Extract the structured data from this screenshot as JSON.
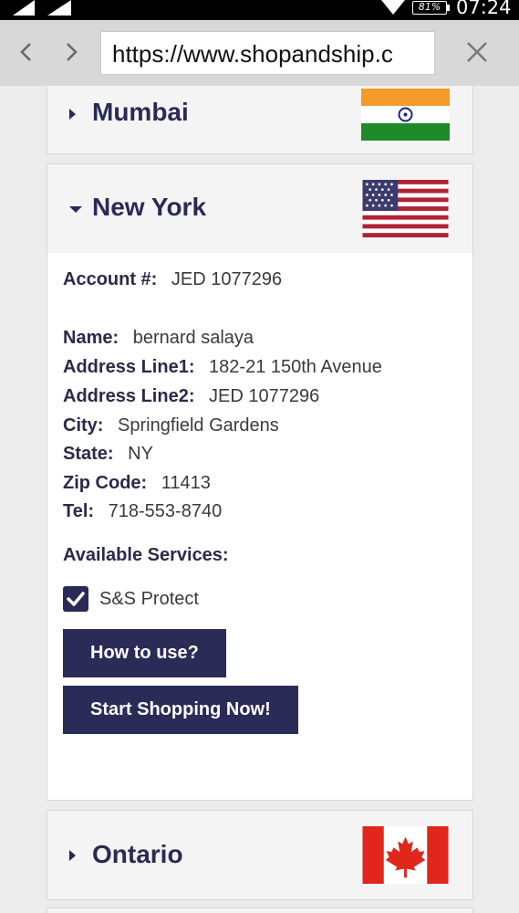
{
  "status_bar": {
    "battery": "81%",
    "time": "07:24"
  },
  "browser": {
    "url": "https://www.shopandship.c"
  },
  "warehouses": {
    "mumbai": {
      "name": "Mumbai",
      "flag_icon": "india-flag-icon"
    },
    "new_york": {
      "name": "New York",
      "flag_icon": "usa-flag-icon"
    },
    "ontario": {
      "name": "Ontario",
      "flag_icon": "canada-flag-icon"
    }
  },
  "account": {
    "account_label": "Account #:",
    "account_value": "JED 1077296",
    "name_label": "Name:",
    "name_value": "bernard salaya",
    "address1_label": "Address Line1:",
    "address1_value": "182-21 150th Avenue",
    "address2_label": "Address Line2:",
    "address2_value": "JED 1077296",
    "city_label": "City:",
    "city_value": "Springfield Gardens",
    "state_label": "State:",
    "state_value": "NY",
    "zip_label": "Zip Code:",
    "zip_value": "11413",
    "tel_label": "Tel:",
    "tel_value": "718-553-8740"
  },
  "services": {
    "title": "Available Services:",
    "protect_label": "S&S Protect",
    "protect_checked": true
  },
  "buttons": {
    "how_to_use": "How to use?",
    "start_shopping": "Start Shopping Now!"
  },
  "colors": {
    "accent": "#2b2b58",
    "panel_bg": "#f4f4f4"
  }
}
